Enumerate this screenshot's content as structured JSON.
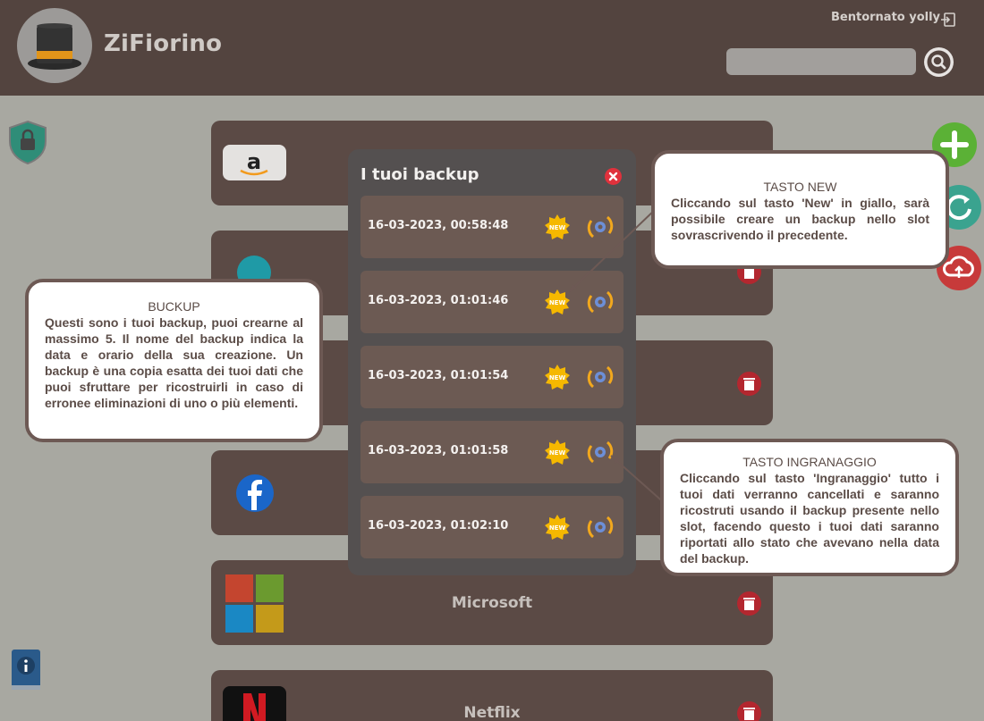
{
  "header": {
    "app_title": "ZiFiorino",
    "welcome_text": "Bentornato yolly",
    "search": {
      "value": "",
      "placeholder": ""
    }
  },
  "accounts": [
    {
      "name": "",
      "logo": "amazon-logo"
    },
    {
      "name": "",
      "logo": "canva-logo"
    },
    {
      "name": "",
      "logo": "none"
    },
    {
      "name": "",
      "logo": "facebook-logo"
    },
    {
      "name": "Microsoft",
      "logo": "microsoft-logo"
    },
    {
      "name": "Netflix",
      "logo": "netflix-logo"
    }
  ],
  "backup_modal": {
    "title": "I tuoi backup",
    "backups": [
      {
        "date": "16-03-2023, 00:58:48",
        "new_label": "NEW"
      },
      {
        "date": "16-03-2023, 01:01:46",
        "new_label": "NEW"
      },
      {
        "date": "16-03-2023, 01:01:54",
        "new_label": "NEW"
      },
      {
        "date": "16-03-2023, 01:01:58",
        "new_label": "NEW"
      },
      {
        "date": "16-03-2023, 01:02:10",
        "new_label": "NEW"
      }
    ]
  },
  "tooltips": {
    "backup": {
      "title": "BUCKUP",
      "text": "Questi sono i tuoi backup, puoi crearne al massimo 5. Il nome del backup indica la data e orario della sua creazione. Un backup è una copia esatta dei tuoi dati che puoi sfruttare per ricostruirli in caso di erronee eliminazioni di uno o più elementi."
    },
    "new": {
      "title": "TASTO NEW",
      "text": "Cliccando sul tasto 'New' in giallo, sarà possibile creare un backup nello slot sovrascrivendo il precedente."
    },
    "gear": {
      "title": "TASTO INGRANAGGIO",
      "text": "Cliccando sul tasto 'Ingranaggio' tutto i tuoi dati verranno cancellati e saranno ricostruti usando il backup presente nello slot, facendo questo i tuoi dati saranno riportati allo stato che avevano nella data del backup."
    }
  },
  "colors": {
    "header_bg": "#53443f",
    "page_bg": "#a8a8a1",
    "card_bg": "#5b4a45",
    "modal_bg": "#545050",
    "backup_row_bg": "#6c5a53",
    "new_badge": "#f5b800",
    "delete_red": "#b3272f",
    "add_green": "#5bb136"
  }
}
